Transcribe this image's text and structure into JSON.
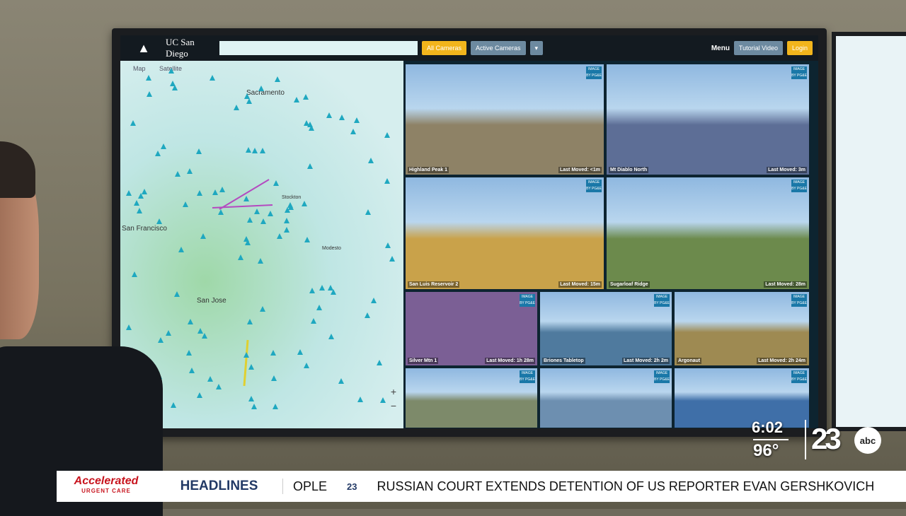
{
  "app": {
    "brand": "UC San Diego",
    "logo": "ALERTCalifornia",
    "buttons": {
      "all_cameras": "All Cameras",
      "active_cameras": "Active Cameras",
      "menu": "Menu",
      "tutorial": "Tutorial Video",
      "login": "Login"
    }
  },
  "map": {
    "tabs": [
      "Map",
      "Satellite"
    ],
    "cities": [
      "Sacramento",
      "San Francisco",
      "San Jose",
      "Stockton",
      "Modesto"
    ],
    "zoom_in": "+",
    "zoom_out": "−"
  },
  "cameras": [
    {
      "name": "Highland Peak 1",
      "moved": "Last Moved: <1m",
      "color": "#8e8266"
    },
    {
      "name": "Mt Diablo North",
      "moved": "Last Moved: 3m",
      "color": "#5d6e96"
    },
    {
      "name": "San Luis Reservoir 2",
      "moved": "Last Moved: 15m",
      "color": "#c9a24a"
    },
    {
      "name": "Sugarloaf Ridge",
      "moved": "Last Moved: 28m",
      "color": "#6c8a4c"
    },
    {
      "name": "Silver Mtn 1",
      "moved": "Last Moved: 1h 28m",
      "color": "#7b5f95"
    },
    {
      "name": "Briones Tabletop",
      "moved": "Last Moved: 2h 2m",
      "color": "#4f7a9e"
    },
    {
      "name": "Argonaut",
      "moved": "Last Moved: 2h 24m",
      "color": "#9e8a52"
    },
    {
      "name": "",
      "moved": "",
      "color": "#7d8a6a"
    },
    {
      "name": "",
      "moved": "",
      "color": "#6d8fb0"
    },
    {
      "name": "",
      "moved": "",
      "color": "#3f6fa8"
    }
  ],
  "badge": "IMAGE BY PG&E",
  "broadcast": {
    "time": "6:02",
    "temp": "96°",
    "station": "23",
    "network": "abc",
    "sponsor": "Accelerated",
    "sponsor_sub": "URGENT CARE",
    "section": "HEADLINES",
    "prev_story": "OPLE",
    "story": "RUSSIAN COURT EXTENDS DETENTION OF US REPORTER EVAN GERSHKOVICH",
    "ticker_logo": "23"
  }
}
